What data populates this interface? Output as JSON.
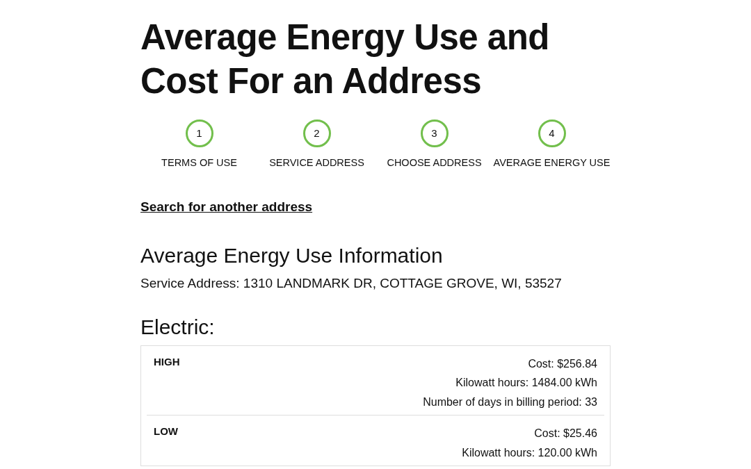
{
  "title": "Average Energy Use and Cost For an Address",
  "steps": [
    {
      "number": "1",
      "label": "TERMS OF USE"
    },
    {
      "number": "2",
      "label": "SERVICE ADDRESS"
    },
    {
      "number": "3",
      "label": "CHOOSE ADDRESS"
    },
    {
      "number": "4",
      "label": "AVERAGE ENERGY USE"
    }
  ],
  "search_link": "Search for another address",
  "section_heading": "Average Energy Use Information",
  "service_address": "Service Address: 1310 LANDMARK DR, COTTAGE GROVE, WI, 53527",
  "electric": {
    "heading": "Electric:",
    "rows": [
      {
        "label": "HIGH",
        "lines": [
          "Cost: $256.84",
          "Kilowatt hours: 1484.00 kWh",
          "Number of days in billing period: 33"
        ]
      },
      {
        "label": "LOW",
        "lines": [
          "Cost: $25.46",
          "Kilowatt hours: 120.00 kWh"
        ]
      }
    ]
  }
}
